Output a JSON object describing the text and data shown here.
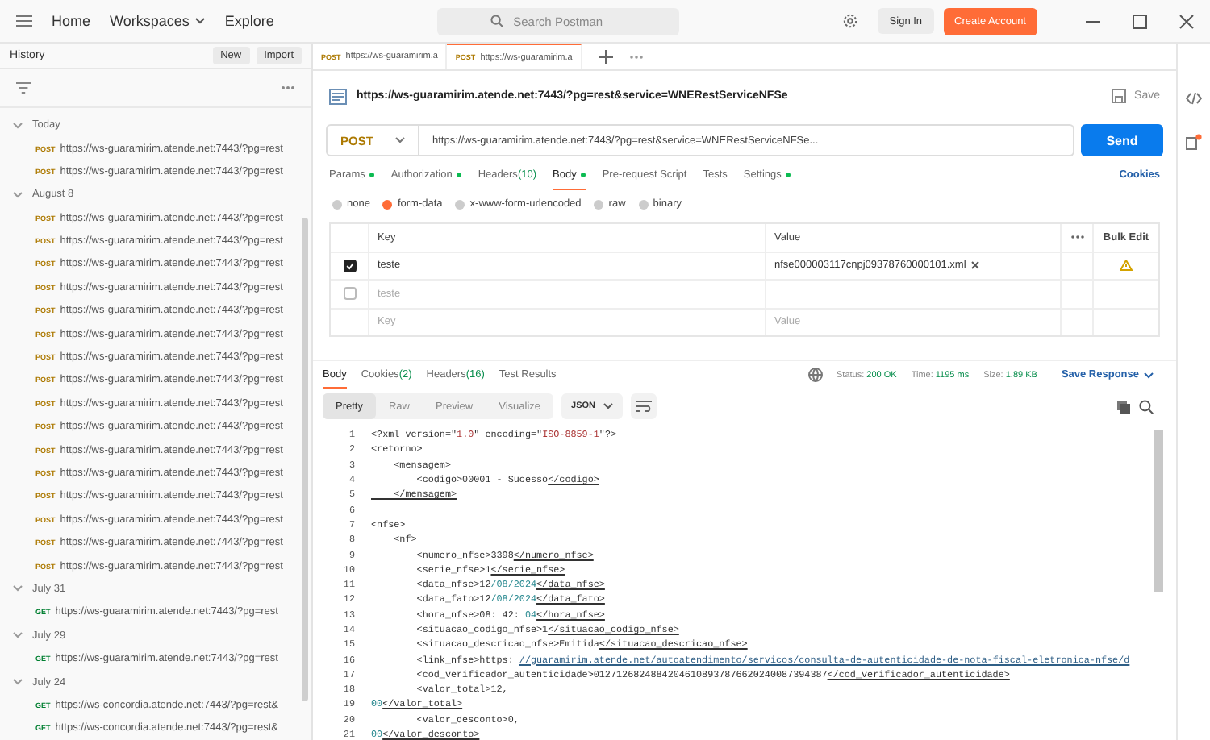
{
  "topbar": {
    "nav": [
      {
        "label": "Home",
        "dropdown": false
      },
      {
        "label": "Workspaces",
        "dropdown": true
      },
      {
        "label": "Explore",
        "dropdown": false
      }
    ],
    "search": {
      "placeholder": "Search Postman"
    },
    "sign_in": "Sign In",
    "create_account": "Create Account"
  },
  "sidebar": {
    "title": "History",
    "new_button": "New",
    "import_button": "Import",
    "groups": [
      {
        "label": "Today",
        "expanded": true,
        "items": [
          {
            "method": "POST",
            "url": "https://ws-guaramirim.atende.net:7443/?pg=rest"
          },
          {
            "method": "POST",
            "url": "https://ws-guaramirim.atende.net:7443/?pg=rest"
          }
        ]
      },
      {
        "label": "August 8",
        "expanded": true,
        "items": [
          {
            "method": "POST",
            "url": "https://ws-guaramirim.atende.net:7443/?pg=rest"
          },
          {
            "method": "POST",
            "url": "https://ws-guaramirim.atende.net:7443/?pg=rest"
          },
          {
            "method": "POST",
            "url": "https://ws-guaramirim.atende.net:7443/?pg=rest"
          },
          {
            "method": "POST",
            "url": "https://ws-guaramirim.atende.net:7443/?pg=rest"
          },
          {
            "method": "POST",
            "url": "https://ws-guaramirim.atende.net:7443/?pg=rest"
          },
          {
            "method": "POST",
            "url": "https://ws-guaramirim.atende.net:7443/?pg=rest"
          },
          {
            "method": "POST",
            "url": "https://ws-guaramirim.atende.net:7443/?pg=rest"
          },
          {
            "method": "POST",
            "url": "https://ws-guaramirim.atende.net:7443/?pg=rest"
          },
          {
            "method": "POST",
            "url": "https://ws-guaramirim.atende.net:7443/?pg=rest"
          },
          {
            "method": "POST",
            "url": "https://ws-guaramirim.atende.net:7443/?pg=rest"
          },
          {
            "method": "POST",
            "url": "https://ws-guaramirim.atende.net:7443/?pg=rest"
          },
          {
            "method": "POST",
            "url": "https://ws-guaramirim.atende.net:7443/?pg=rest"
          },
          {
            "method": "POST",
            "url": "https://ws-guaramirim.atende.net:7443/?pg=rest"
          },
          {
            "method": "POST",
            "url": "https://ws-guaramirim.atende.net:7443/?pg=rest"
          },
          {
            "method": "POST",
            "url": "https://ws-guaramirim.atende.net:7443/?pg=rest"
          },
          {
            "method": "POST",
            "url": "https://ws-guaramirim.atende.net:7443/?pg=rest"
          }
        ]
      },
      {
        "label": "July 31",
        "expanded": true,
        "items": [
          {
            "method": "GET",
            "url": "https://ws-guaramirim.atende.net:7443/?pg=rest"
          }
        ]
      },
      {
        "label": "July 29",
        "expanded": true,
        "items": [
          {
            "method": "GET",
            "url": "https://ws-guaramirim.atende.net:7443/?pg=rest"
          }
        ]
      },
      {
        "label": "July 24",
        "expanded": true,
        "items": [
          {
            "method": "GET",
            "url": "https://ws-concordia.atende.net:7443/?pg=rest&"
          },
          {
            "method": "GET",
            "url": "https://ws-concordia.atende.net:7443/?pg=rest&"
          }
        ]
      }
    ]
  },
  "tabs": [
    {
      "method": "POST",
      "label": "https://ws-guaramirim.a",
      "selected": false
    },
    {
      "method": "POST",
      "label": "https://ws-guaramirim.a",
      "selected": true
    }
  ],
  "request": {
    "title": "https://ws-guaramirim.atende.net:7443/?pg=rest&service=WNERestServiceNFSe",
    "save": "Save",
    "method": "POST",
    "url": "https://ws-guaramirim.atende.net:7443/?pg=rest&service=WNERestServiceNFSe...",
    "send": "Send",
    "tabs": [
      {
        "label": "Params",
        "dot": true,
        "selected": false
      },
      {
        "label": "Authorization",
        "dot": true,
        "selected": false
      },
      {
        "label": "Headers",
        "count": "(10)",
        "dot": false,
        "selected": false
      },
      {
        "label": "Body",
        "dot": true,
        "selected": true
      },
      {
        "label": "Pre-request Script",
        "dot": false,
        "selected": false
      },
      {
        "label": "Tests",
        "dot": false,
        "selected": false
      },
      {
        "label": "Settings",
        "dot": true,
        "selected": false
      }
    ],
    "cookies": "Cookies",
    "body_types": [
      {
        "label": "none",
        "selected": false
      },
      {
        "label": "form-data",
        "selected": true
      },
      {
        "label": "x-www-form-urlencoded",
        "selected": false
      },
      {
        "label": "raw",
        "selected": false
      },
      {
        "label": "binary",
        "selected": false
      }
    ],
    "table": {
      "columns": [
        "Key",
        "Value",
        "Bulk Edit"
      ],
      "rows": [
        {
          "checked": true,
          "key": "teste",
          "value": "nfse000003117cnpj09378760000101.xml",
          "kind": "file",
          "warning": true
        },
        {
          "checked": false,
          "key": "teste",
          "value": "",
          "kind": "text",
          "warning": false
        }
      ],
      "new_row": {
        "key_placeholder": "Key",
        "value_placeholder": "Value"
      }
    }
  },
  "response": {
    "tabs": [
      {
        "label": "Body",
        "selected": true
      },
      {
        "label": "Cookies",
        "count": "(2)",
        "selected": false
      },
      {
        "label": "Headers",
        "count": "(16)",
        "selected": false
      },
      {
        "label": "Test Results",
        "selected": false
      }
    ],
    "status": {
      "label": "Status:",
      "value": "200 OK"
    },
    "time": {
      "label": "Time:",
      "value": "1195 ms"
    },
    "size": {
      "label": "Size:",
      "value": "1.89 KB"
    },
    "save_response": "Save Response",
    "views": [
      {
        "label": "Pretty",
        "selected": true
      },
      {
        "label": "Raw",
        "selected": false
      },
      {
        "label": "Preview",
        "selected": false
      },
      {
        "label": "Visualize",
        "selected": false
      }
    ],
    "format": "JSON",
    "lines": [
      {
        "number": "1",
        "segments": [
          {
            "kind": "text",
            "text": "<?xml version=\""
          },
          {
            "kind": "string",
            "text": "1.0"
          },
          {
            "kind": "text",
            "text": "\" encoding=\""
          },
          {
            "kind": "string",
            "text": "ISO-8859-1"
          },
          {
            "kind": "text",
            "text": "\"?>"
          }
        ]
      },
      {
        "number": "2",
        "segments": [
          {
            "kind": "text",
            "text": "<retorno>"
          }
        ]
      },
      {
        "number": "3",
        "segments": [
          {
            "kind": "text",
            "text": "    <mensagem>"
          }
        ]
      },
      {
        "number": "4",
        "segments": [
          {
            "kind": "text",
            "text": "        <codigo>00001 - Sucesso"
          },
          {
            "kind": "close",
            "text": "</codigo>"
          }
        ]
      },
      {
        "number": "5",
        "segments": [
          {
            "kind": "close",
            "text": "    </mensagem>"
          }
        ]
      },
      {
        "number": "6"
      },
      {
        "number": "7",
        "segments": [
          {
            "kind": "text",
            "text": "<nfse>"
          }
        ]
      },
      {
        "number": "8",
        "segments": [
          {
            "kind": "text",
            "text": "    <nf>"
          }
        ]
      },
      {
        "number": "9",
        "segments": [
          {
            "kind": "text",
            "text": "        <numero_nfse>3398"
          },
          {
            "kind": "close",
            "text": "</numero_nfse>"
          }
        ]
      },
      {
        "number": "10",
        "segments": [
          {
            "kind": "text",
            "text": "        <serie_nfse>1"
          },
          {
            "kind": "close",
            "text": "</serie_nfse>"
          }
        ]
      },
      {
        "number": "11",
        "segments": [
          {
            "kind": "text",
            "text": "        <data_nfse>12"
          },
          {
            "kind": "number",
            "text": "/08/2024"
          },
          {
            "kind": "close",
            "text": "</data_nfse>"
          }
        ]
      },
      {
        "number": "12",
        "segments": [
          {
            "kind": "text",
            "text": "        <data_fato>12"
          },
          {
            "kind": "number",
            "text": "/08/2024"
          },
          {
            "kind": "close",
            "text": "</data_fato>"
          }
        ]
      },
      {
        "number": "13",
        "segments": [
          {
            "kind": "text",
            "text": "        <hora_nfse>08: 42: "
          },
          {
            "kind": "number",
            "text": "04"
          },
          {
            "kind": "close",
            "text": "</hora_nfse>"
          }
        ]
      },
      {
        "number": "14",
        "segments": [
          {
            "kind": "text",
            "text": "        <situacao_codigo_nfse>1"
          },
          {
            "kind": "close",
            "text": "</situacao_codigo_nfse>"
          }
        ]
      },
      {
        "number": "15",
        "segments": [
          {
            "kind": "text",
            "text": "        <situacao_descricao_nfse>Emitida"
          },
          {
            "kind": "close",
            "text": "</situacao_descricao_nfse>"
          }
        ]
      },
      {
        "number": "16",
        "segments": [
          {
            "kind": "text",
            "text": "        <link_nfse>https: "
          },
          {
            "kind": "link",
            "text": "//guaramirim.atende.net/autoatendimento/servicos/consulta-de-autenticidade-de-nota-fiscal-eletronica-nfse/d"
          }
        ]
      },
      {
        "number": "17",
        "segments": [
          {
            "kind": "text",
            "text": "        <cod_verificador_autenticidade>01271268248842046108937876620240087394387"
          },
          {
            "kind": "close",
            "text": "</cod_verificador_autenticidade>"
          }
        ]
      },
      {
        "number": "18",
        "segments": [
          {
            "kind": "text",
            "text": "        <valor_total>12,"
          }
        ]
      },
      {
        "number": "19",
        "segments": [
          {
            "kind": "number",
            "text": "00"
          },
          {
            "kind": "close",
            "text": "</valor_total>"
          }
        ]
      },
      {
        "number": "20",
        "segments": [
          {
            "kind": "text",
            "text": "        <valor_desconto>0,"
          }
        ]
      },
      {
        "number": "21",
        "segments": [
          {
            "kind": "number",
            "text": "00"
          },
          {
            "kind": "close",
            "text": "</valor_desconto>"
          }
        ]
      }
    ]
  }
}
